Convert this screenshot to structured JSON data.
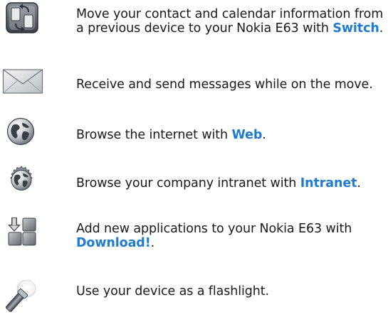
{
  "features": [
    {
      "icon": "switch-icon",
      "before": "Move your contact and calendar information from a previous device to your Nokia E63 with ",
      "link": "Switch",
      "after": "."
    },
    {
      "icon": "envelope-icon",
      "before": "Receive and send messages while on the move.",
      "link": "",
      "after": ""
    },
    {
      "icon": "globe-icon",
      "before": "Browse the internet with ",
      "link": "Web",
      "after": "."
    },
    {
      "icon": "intranet-globe-icon",
      "before": "Browse your company intranet with ",
      "link": "Intranet",
      "after": "."
    },
    {
      "icon": "download-icon",
      "before": "Add new applications to your Nokia E63 with ",
      "link": "Download!",
      "after": "."
    },
    {
      "icon": "flashlight-icon",
      "before": "Use your device as a flashlight.",
      "link": "",
      "after": ""
    }
  ],
  "colors": {
    "link": "#1f7ad1",
    "text": "#1a1a1a"
  }
}
